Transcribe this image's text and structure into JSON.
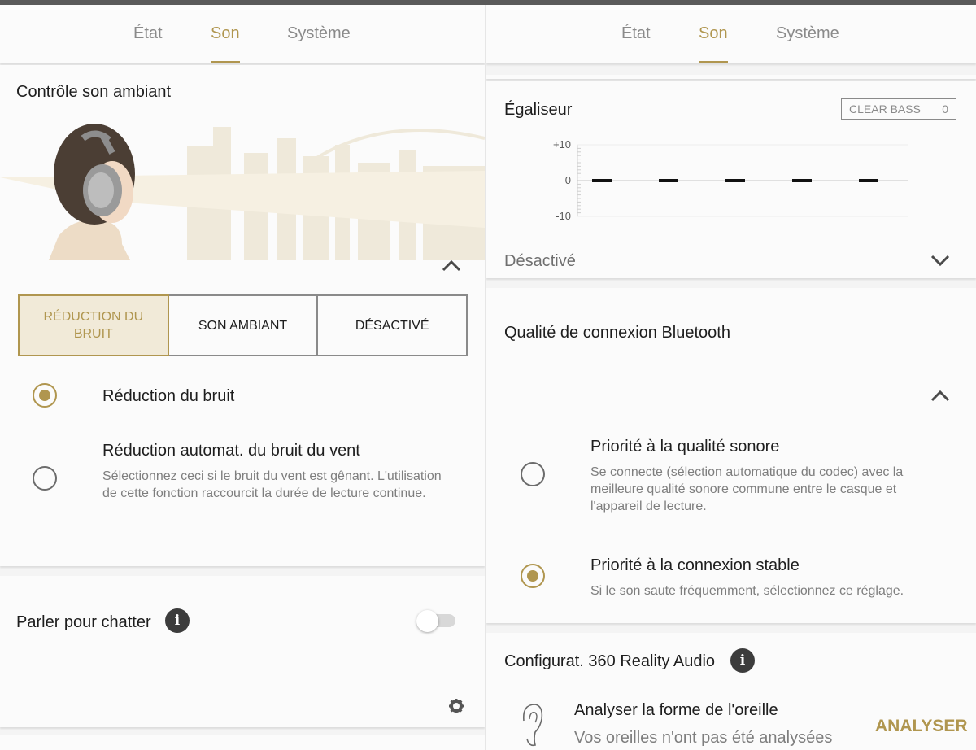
{
  "left": {
    "tabs": [
      {
        "label": "État",
        "active": false
      },
      {
        "label": "Son",
        "active": true
      },
      {
        "label": "Système",
        "active": false
      }
    ],
    "ambient": {
      "title": "Contrôle son ambiant",
      "modes": [
        "RÉDUCTION DU BRUIT",
        "SON AMBIANT",
        "DÉSACTIVÉ"
      ],
      "selected_mode": "RÉDUCTION DU BRUIT",
      "options": [
        {
          "title": "Réduction du bruit",
          "description": "",
          "selected": true
        },
        {
          "title": "Réduction automat. du bruit du vent",
          "description": "Sélectionnez ceci si le bruit du vent est gênant. L'utilisation de cette fonction raccourcit la durée de lecture continue.",
          "selected": false
        }
      ]
    },
    "speak_to_chat": {
      "title": "Parler pour chatter",
      "enabled": false
    }
  },
  "right": {
    "tabs": [
      {
        "label": "État",
        "active": false
      },
      {
        "label": "Son",
        "active": true
      },
      {
        "label": "Système",
        "active": false
      }
    ],
    "equalizer": {
      "title": "Égaliseur",
      "clear_bass_label": "CLEAR BASS",
      "clear_bass_value": "0",
      "axis_labels": [
        "+10",
        "0",
        "-10"
      ],
      "band_levels": [
        0,
        0,
        0,
        0,
        0
      ],
      "preset": "Désactivé"
    },
    "bluetooth": {
      "title": "Qualité de connexion Bluetooth",
      "options": [
        {
          "title": "Priorité à la qualité sonore",
          "description": "Se connecte (sélection automatique du codec) avec la meilleure qualité sonore commune entre le casque et l'appareil de lecture.",
          "selected": false
        },
        {
          "title": "Priorité à la connexion stable",
          "description": "Si le son saute fréquemment, sélectionnez ce réglage.",
          "selected": true
        }
      ]
    },
    "reality_audio": {
      "title": "Configurat. 360 Reality Audio",
      "item_title": "Analyser la forme de l'oreille",
      "item_status": "Vos oreilles n'ont pas été analysées",
      "action_label": "ANALYSER"
    }
  },
  "colors": {
    "accent": "#b0964f",
    "accent_bg": "#f1ead8",
    "card": "#fbfbfb",
    "background": "#f4f4f4"
  }
}
